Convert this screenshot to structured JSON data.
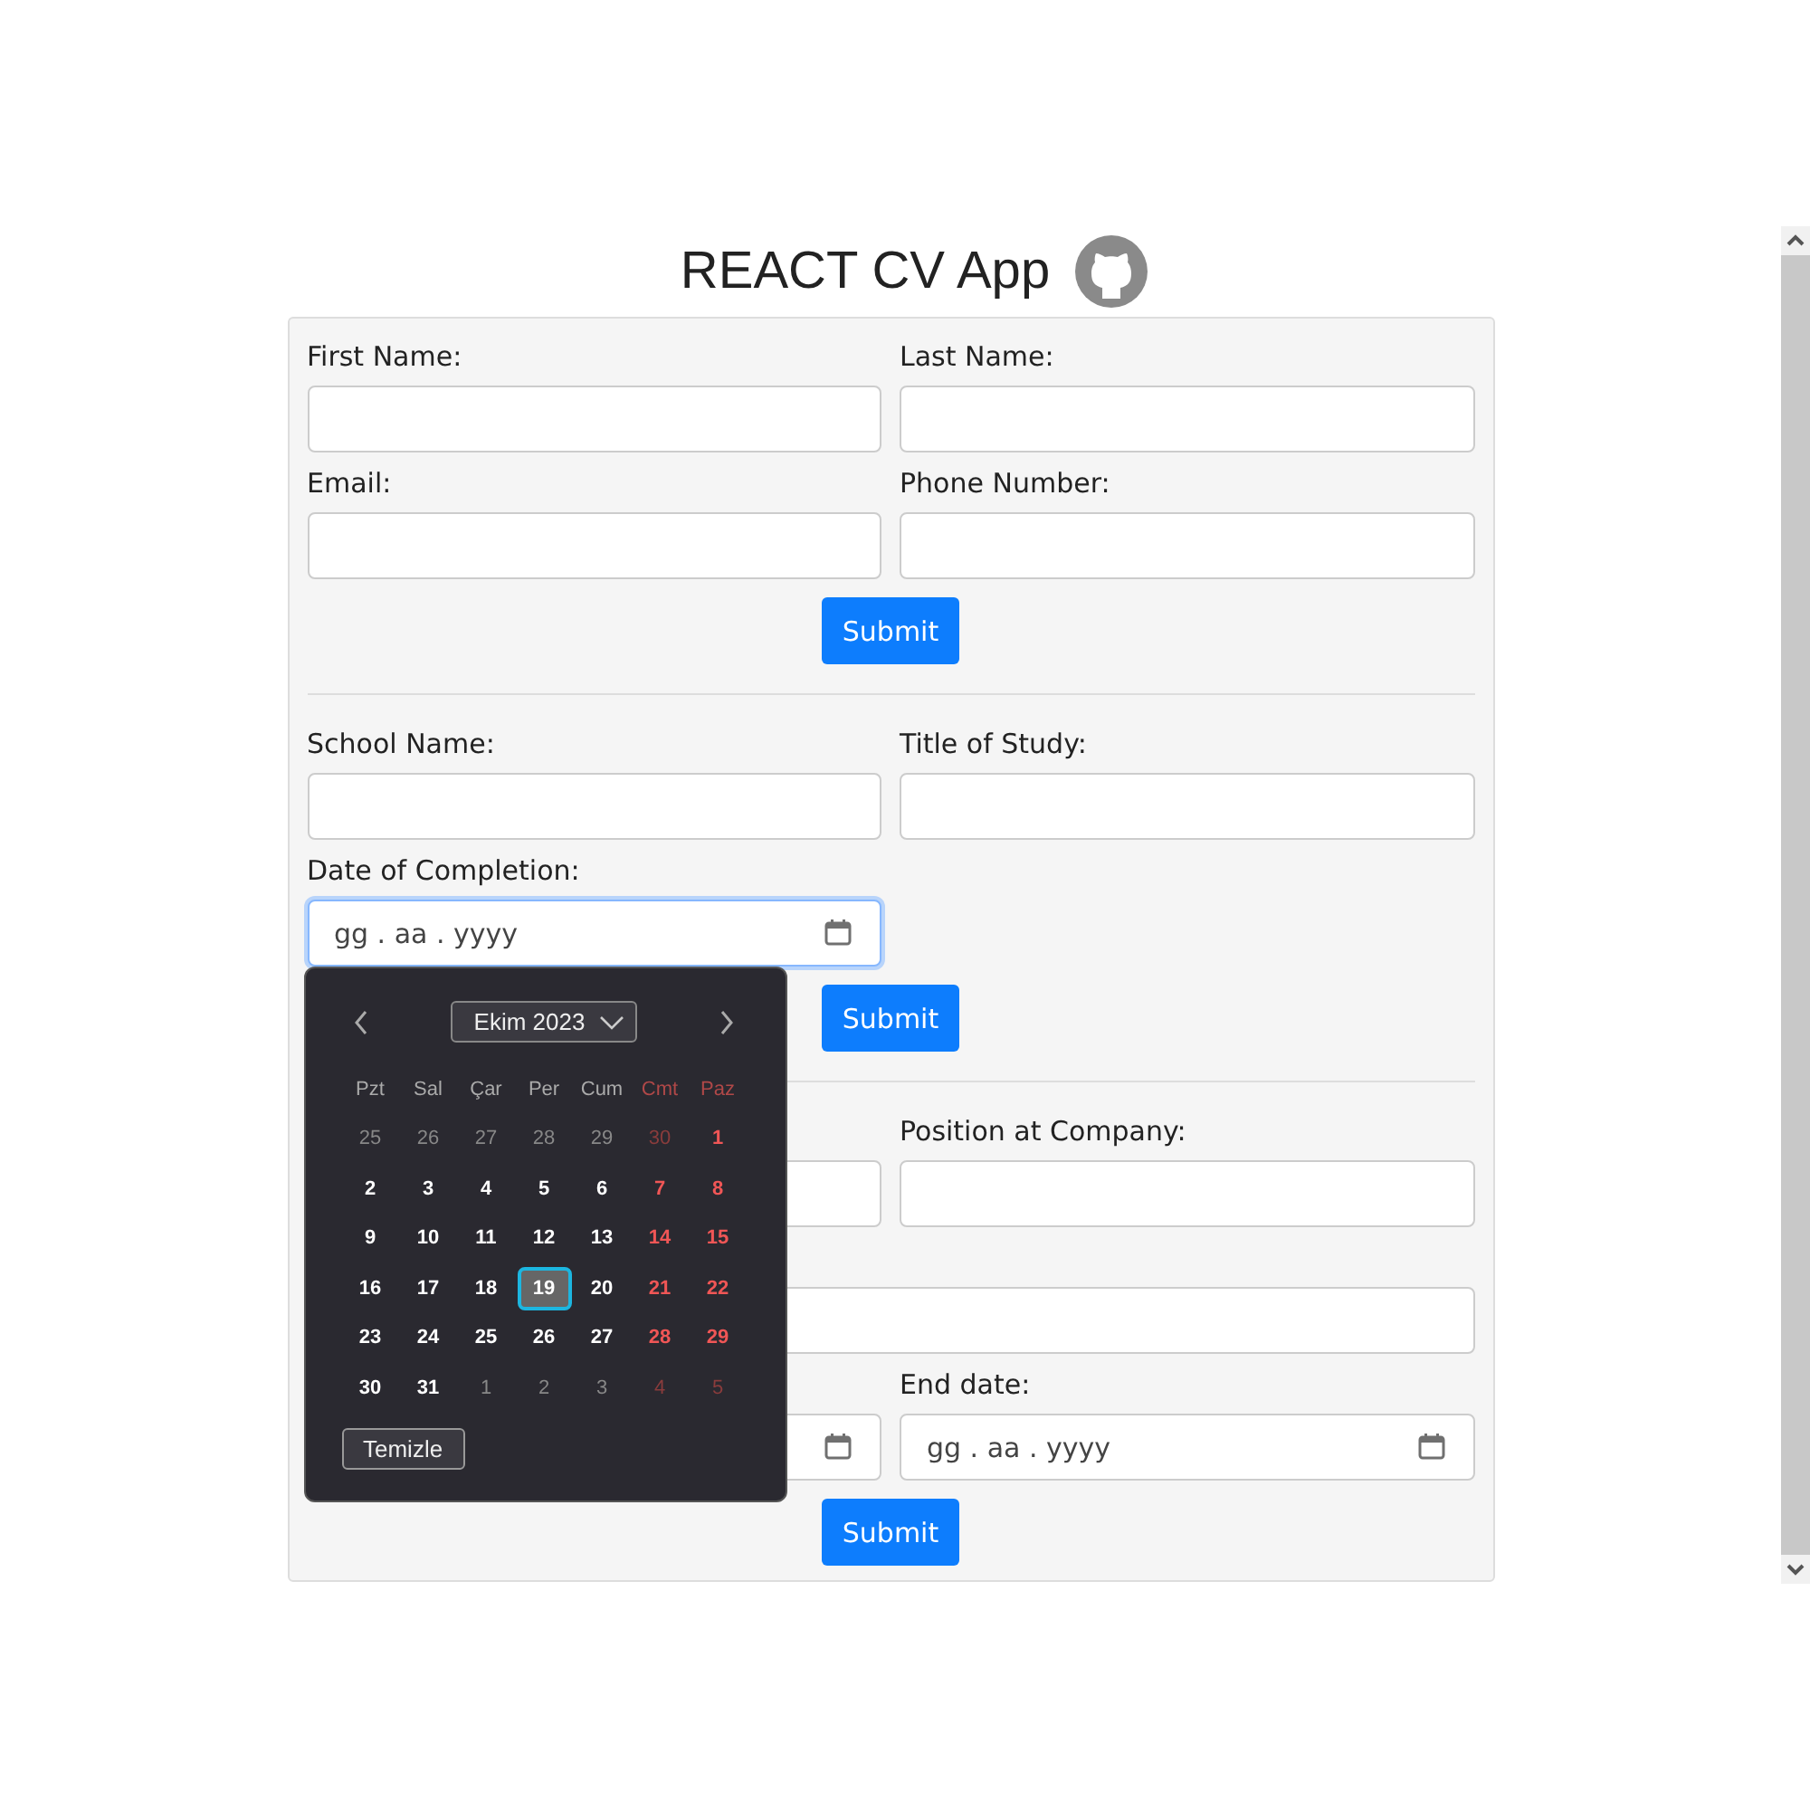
{
  "title": "REACT CV App",
  "sections": [
    {
      "fields": [
        {
          "label": "First Name:",
          "kind": "text",
          "full_width": false,
          "focused": false
        },
        {
          "label": "Last Name:",
          "kind": "text",
          "full_width": false,
          "focused": false
        },
        {
          "label": "Email:",
          "kind": "text",
          "full_width": false,
          "focused": false
        },
        {
          "label": "Phone Number:",
          "kind": "text",
          "full_width": false,
          "focused": false
        }
      ],
      "button": "Submit"
    },
    {
      "fields": [
        {
          "label": "School Name:",
          "kind": "text",
          "full_width": false,
          "focused": false
        },
        {
          "label": "Title of Study:",
          "kind": "text",
          "full_width": false,
          "focused": false
        },
        {
          "label": "Date of Completion:",
          "kind": "date",
          "full_width": false,
          "focused": true,
          "placeholder": "gg . aa . yyyy",
          "date_picker": {
            "month": "Ekim 2023",
            "clear_button": "Temizle",
            "weekdays": [
              {
                "label": "Pzt",
                "weekend": false
              },
              {
                "label": "Sal",
                "weekend": false
              },
              {
                "label": "Çar",
                "weekend": false
              },
              {
                "label": "Per",
                "weekend": false
              },
              {
                "label": "Cum",
                "weekend": false
              },
              {
                "label": "Cmt",
                "weekend": true
              },
              {
                "label": "Paz",
                "weekend": true
              }
            ],
            "days": [
              {
                "label": "25",
                "muted": true,
                "weekend": false,
                "selected": false
              },
              {
                "label": "26",
                "muted": true,
                "weekend": false,
                "selected": false
              },
              {
                "label": "27",
                "muted": true,
                "weekend": false,
                "selected": false
              },
              {
                "label": "28",
                "muted": true,
                "weekend": false,
                "selected": false
              },
              {
                "label": "29",
                "muted": true,
                "weekend": false,
                "selected": false
              },
              {
                "label": "30",
                "muted": true,
                "weekend": true,
                "selected": false
              },
              {
                "label": "1",
                "muted": false,
                "weekend": true,
                "selected": false
              },
              {
                "label": "2",
                "muted": false,
                "weekend": false,
                "selected": false
              },
              {
                "label": "3",
                "muted": false,
                "weekend": false,
                "selected": false
              },
              {
                "label": "4",
                "muted": false,
                "weekend": false,
                "selected": false
              },
              {
                "label": "5",
                "muted": false,
                "weekend": false,
                "selected": false
              },
              {
                "label": "6",
                "muted": false,
                "weekend": false,
                "selected": false
              },
              {
                "label": "7",
                "muted": false,
                "weekend": true,
                "selected": false
              },
              {
                "label": "8",
                "muted": false,
                "weekend": true,
                "selected": false
              },
              {
                "label": "9",
                "muted": false,
                "weekend": false,
                "selected": false
              },
              {
                "label": "10",
                "muted": false,
                "weekend": false,
                "selected": false
              },
              {
                "label": "11",
                "muted": false,
                "weekend": false,
                "selected": false
              },
              {
                "label": "12",
                "muted": false,
                "weekend": false,
                "selected": false
              },
              {
                "label": "13",
                "muted": false,
                "weekend": false,
                "selected": false
              },
              {
                "label": "14",
                "muted": false,
                "weekend": true,
                "selected": false
              },
              {
                "label": "15",
                "muted": false,
                "weekend": true,
                "selected": false
              },
              {
                "label": "16",
                "muted": false,
                "weekend": false,
                "selected": false
              },
              {
                "label": "17",
                "muted": false,
                "weekend": false,
                "selected": false
              },
              {
                "label": "18",
                "muted": false,
                "weekend": false,
                "selected": false
              },
              {
                "label": "19",
                "muted": false,
                "weekend": false,
                "selected": true
              },
              {
                "label": "20",
                "muted": false,
                "weekend": false,
                "selected": false
              },
              {
                "label": "21",
                "muted": false,
                "weekend": true,
                "selected": false
              },
              {
                "label": "22",
                "muted": false,
                "weekend": true,
                "selected": false
              },
              {
                "label": "23",
                "muted": false,
                "weekend": false,
                "selected": false
              },
              {
                "label": "24",
                "muted": false,
                "weekend": false,
                "selected": false
              },
              {
                "label": "25",
                "muted": false,
                "weekend": false,
                "selected": false
              },
              {
                "label": "26",
                "muted": false,
                "weekend": false,
                "selected": false
              },
              {
                "label": "27",
                "muted": false,
                "weekend": false,
                "selected": false
              },
              {
                "label": "28",
                "muted": false,
                "weekend": true,
                "selected": false
              },
              {
                "label": "29",
                "muted": false,
                "weekend": true,
                "selected": false
              },
              {
                "label": "30",
                "muted": false,
                "weekend": false,
                "selected": false
              },
              {
                "label": "31",
                "muted": false,
                "weekend": false,
                "selected": false
              },
              {
                "label": "1",
                "muted": true,
                "weekend": false,
                "selected": false
              },
              {
                "label": "2",
                "muted": true,
                "weekend": false,
                "selected": false
              },
              {
                "label": "3",
                "muted": true,
                "weekend": false,
                "selected": false
              },
              {
                "label": "4",
                "muted": true,
                "weekend": true,
                "selected": false
              },
              {
                "label": "5",
                "muted": true,
                "weekend": true,
                "selected": false
              }
            ]
          }
        }
      ],
      "button": "Submit"
    },
    {
      "fields": [
        {
          "kind": "text",
          "full_width": false,
          "focused": false
        },
        {
          "label": "Position at Company:",
          "kind": "text",
          "full_width": false,
          "focused": false
        },
        {
          "kind": "text",
          "full_width": true,
          "focused": false
        },
        {
          "kind": "date",
          "full_width": false,
          "focused": false
        },
        {
          "label": "End date:",
          "kind": "date",
          "full_width": false,
          "focused": false,
          "placeholder": "gg . aa . yyyy"
        }
      ],
      "button": "Submit"
    }
  ]
}
